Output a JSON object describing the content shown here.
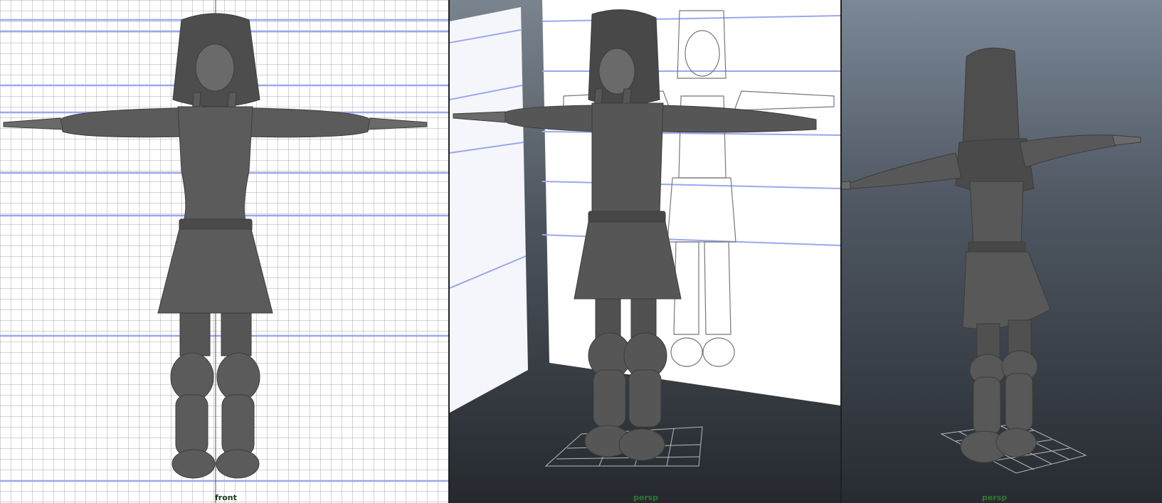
{
  "viewports": [
    {
      "id": "front",
      "camera": "front"
    },
    {
      "id": "persp_1",
      "camera": "persp"
    },
    {
      "id": "persp_2",
      "camera": "persp"
    }
  ],
  "colors": {
    "model_gray": "#555555",
    "grid_line": "#a9a9a9",
    "guide_line": "#9aa8ee",
    "camera_label_front": "#123a12",
    "camera_label_persp": "#2e7a31"
  }
}
